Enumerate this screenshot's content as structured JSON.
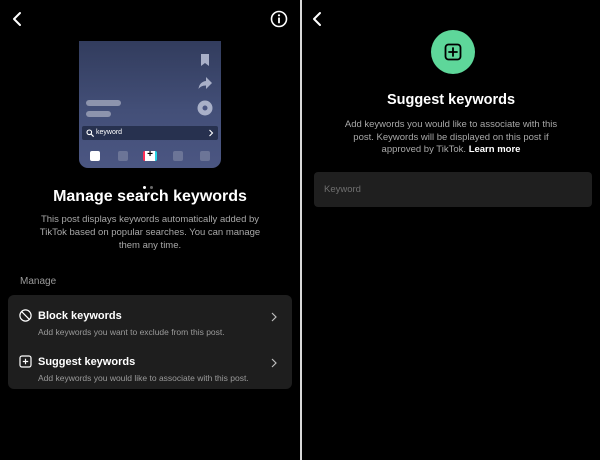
{
  "left": {
    "mockup": {
      "search_text": "keyword"
    },
    "title": "Manage search keywords",
    "description": "This post displays keywords automatically added by TikTok based on popular searches. You can manage them any time.",
    "section_label": "Manage",
    "options": [
      {
        "title": "Block keywords",
        "subtitle": "Add keywords you want to exclude from this post.",
        "icon": "block-icon"
      },
      {
        "title": "Suggest keywords",
        "subtitle": "Add keywords you would like to associate with this post.",
        "icon": "plus-square-icon"
      }
    ],
    "pager": {
      "count": 2,
      "active": 1
    }
  },
  "right": {
    "title": "Suggest keywords",
    "description": "Add keywords you would like to associate with this post. Keywords will be displayed on this post if approved by TikTok.",
    "learn_more": "Learn more",
    "input": {
      "placeholder": "Keyword",
      "value": ""
    }
  },
  "colors": {
    "background": "#000000",
    "card": "#1e1e1e",
    "accent_green": "#5ed79a",
    "muted_text": "#a8a8a8"
  }
}
